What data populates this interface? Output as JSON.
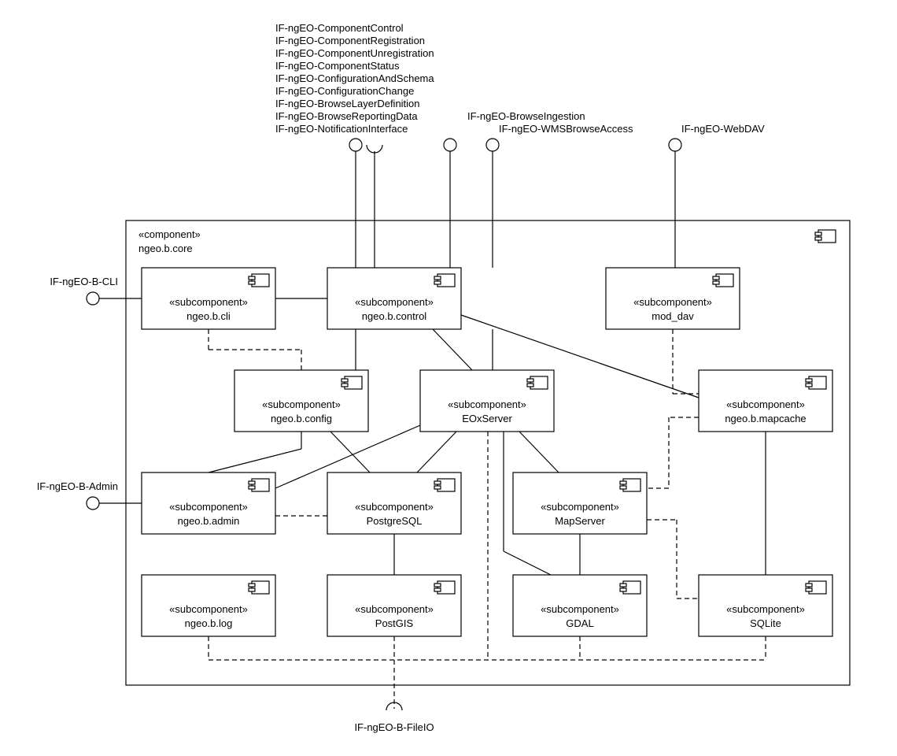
{
  "component": {
    "stereotype": "«component»",
    "name": "ngeo.b.core"
  },
  "subcomponents": {
    "cli": {
      "stereotype": "«subcomponent»",
      "name": "ngeo.b.cli"
    },
    "control": {
      "stereotype": "«subcomponent»",
      "name": "ngeo.b.control"
    },
    "moddav": {
      "stereotype": "«subcomponent»",
      "name": "mod_dav"
    },
    "config": {
      "stereotype": "«subcomponent»",
      "name": "ngeo.b.config"
    },
    "eox": {
      "stereotype": "«subcomponent»",
      "name": "EOxServer"
    },
    "mapcache": {
      "stereotype": "«subcomponent»",
      "name": "ngeo.b.mapcache"
    },
    "admin": {
      "stereotype": "«subcomponent»",
      "name": "ngeo.b.admin"
    },
    "postgresql": {
      "stereotype": "«subcomponent»",
      "name": "PostgreSQL"
    },
    "mapserver": {
      "stereotype": "«subcomponent»",
      "name": "MapServer"
    },
    "log": {
      "stereotype": "«subcomponent»",
      "name": "ngeo.b.log"
    },
    "postgis": {
      "stereotype": "«subcomponent»",
      "name": "PostGIS"
    },
    "gdal": {
      "stereotype": "«subcomponent»",
      "name": "GDAL"
    },
    "sqlite": {
      "stereotype": "«subcomponent»",
      "name": "SQLite"
    }
  },
  "interfaces": {
    "cli_if": "IF-ngEO-B-CLI",
    "admin_if": "IF-ngEO-B-Admin",
    "browseIngestion": "IF-ngEO-BrowseIngestion",
    "wms": "IF-ngEO-WMSBrowseAccess",
    "webdav": "IF-ngEO-WebDAV",
    "fileio": "IF-ngEO-B-FileIO",
    "control_group": [
      "IF-ngEO-ComponentControl",
      "IF-ngEO-ComponentRegistration",
      "IF-ngEO-ComponentUnregistration",
      "IF-ngEO-ComponentStatus",
      "IF-ngEO-ConfigurationAndSchema",
      "IF-ngEO-ConfigurationChange",
      "IF-ngEO-BrowseLayerDefinition",
      "IF-ngEO-BrowseReportingData",
      "IF-ngEO-NotificationInterface"
    ]
  }
}
